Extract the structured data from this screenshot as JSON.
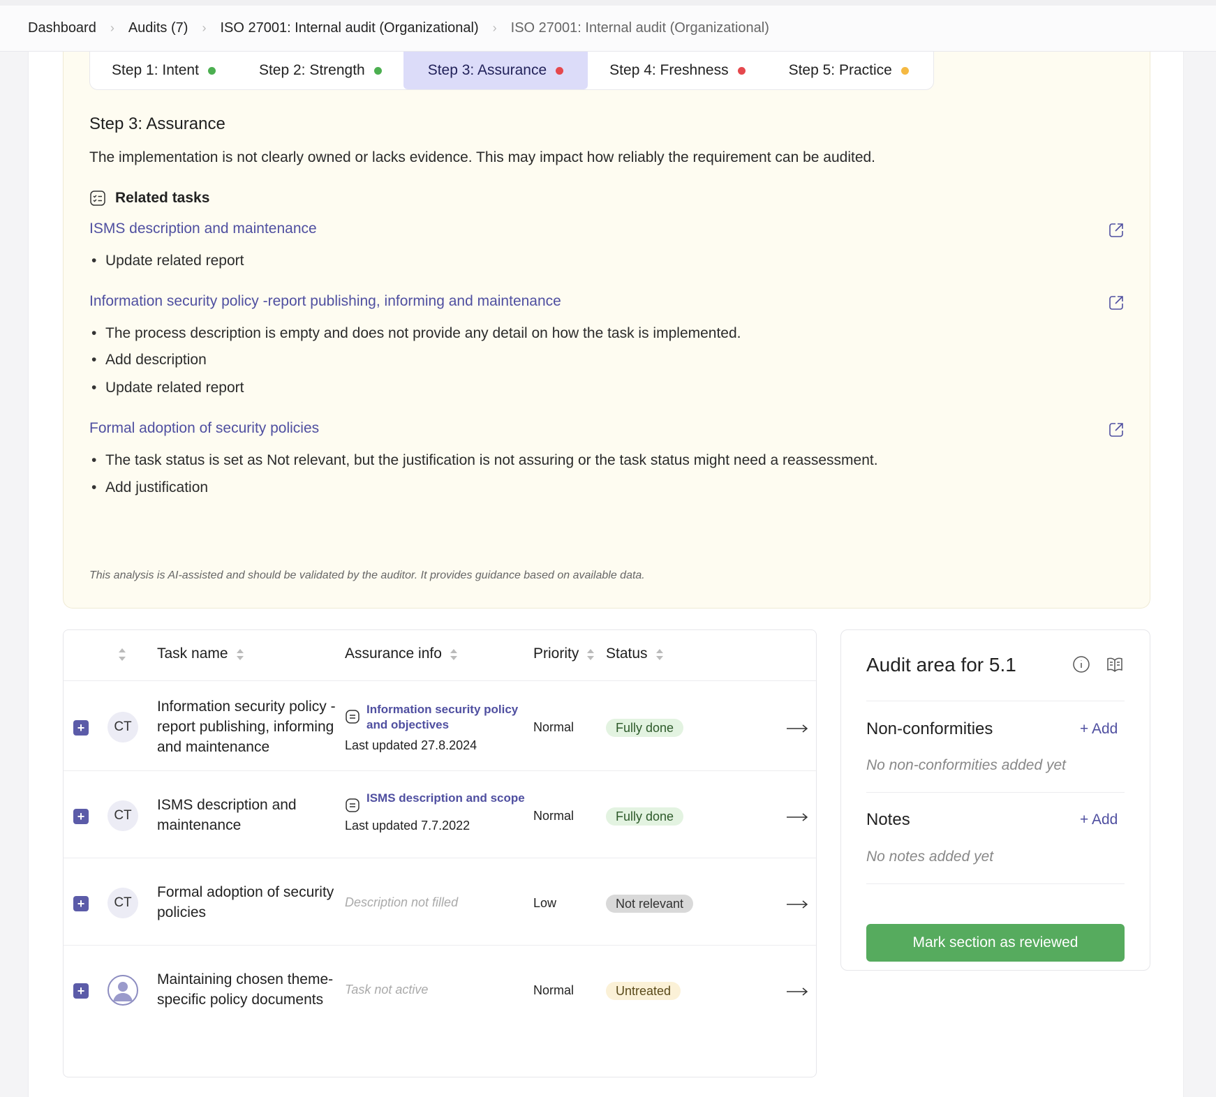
{
  "breadcrumb": [
    "Dashboard",
    "Audits (7)",
    "ISO 27001: Internal audit (Organizational)",
    "ISO 27001: Internal audit (Organizational)"
  ],
  "steps": [
    {
      "label": "Step 1: Intent",
      "status_color": "#4caf50"
    },
    {
      "label": "Step 2: Strength",
      "status_color": "#4caf50"
    },
    {
      "label": "Step 3: Assurance",
      "status_color": "#e5484d",
      "active": true
    },
    {
      "label": "Step 4: Freshness",
      "status_color": "#e5484d"
    },
    {
      "label": "Step 5: Practice",
      "status_color": "#f5b942"
    }
  ],
  "analysis": {
    "title": "Step 3: Assurance",
    "description": "The implementation is not clearly owned or lacks evidence. This may impact how reliably the requirement can be audited.",
    "related_heading": "Related tasks",
    "tasks": [
      {
        "name": "ISMS description and maintenance",
        "bullets": [
          "Update related report"
        ]
      },
      {
        "name": "Information security policy -report publishing, informing and maintenance",
        "bullets": [
          "The process description is empty and does not provide any detail on how the task is implemented.",
          "Add description",
          "Update related report"
        ]
      },
      {
        "name": "Formal adoption of security policies",
        "bullets": [
          "The task status is set as Not relevant, but the justification is not assuring or the task status might need a reassessment.",
          "Add justification"
        ]
      }
    ],
    "ai_note": "This analysis is AI-assisted and should be validated by the auditor. It provides guidance based on available data."
  },
  "table": {
    "headers": {
      "task": "Task name",
      "assurance": "Assurance info",
      "priority": "Priority",
      "status": "Status"
    },
    "rows": [
      {
        "avatar": "CT",
        "task": "Information security policy -report publishing, informing and maintenance",
        "doc": "Information security policy and objectives",
        "updated": "Last updated 27.8.2024",
        "priority": "Normal",
        "status": "Fully done"
      },
      {
        "avatar": "CT",
        "task": "ISMS description and maintenance",
        "doc": "ISMS description and scope",
        "updated": "Last updated 7.7.2022",
        "priority": "Normal",
        "status": "Fully done"
      },
      {
        "avatar": "CT",
        "task": "Formal adoption of security policies",
        "empty_info": "Description not filled",
        "priority": "Low",
        "status": "Not relevant"
      },
      {
        "avatar": "",
        "task": "Maintaining chosen theme-specific policy documents",
        "empty_info": "Task not active",
        "priority": "Normal",
        "status": "Untreated"
      }
    ]
  },
  "side": {
    "title": "Audit area for 5.1",
    "nonconf_heading": "Non-conformities",
    "nonconf_add": "+ Add",
    "nonconf_empty": "No non-conformities added yet",
    "notes_heading": "Notes",
    "notes_add": "+ Add",
    "notes_empty": "No notes added yet",
    "review_button": "Mark section as reviewed"
  }
}
